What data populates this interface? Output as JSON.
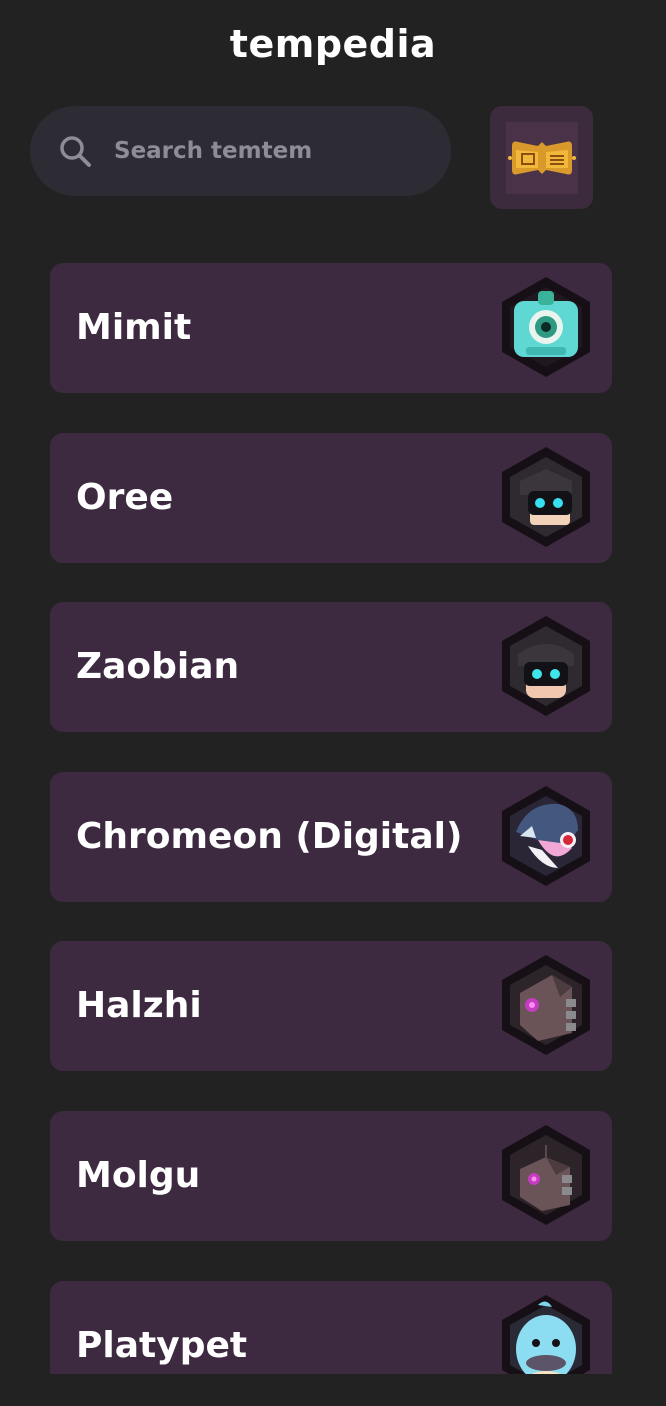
{
  "app": {
    "title": "tempedia"
  },
  "search": {
    "placeholder": "Search temtem",
    "value": ""
  },
  "tempedia_button": {
    "icon": "tempedia-book-icon"
  },
  "colors": {
    "background": "#222222",
    "card": "#3d2a40",
    "search_bg": "#2d2b33",
    "text": "#ffffff",
    "placeholder": "#8e8c94"
  },
  "temtem": [
    {
      "name": "Mimit",
      "icon": "mimit-portrait-icon"
    },
    {
      "name": "Oree",
      "icon": "oree-portrait-icon"
    },
    {
      "name": "Zaobian",
      "icon": "zaobian-portrait-icon"
    },
    {
      "name": "Chromeon (Digital)",
      "icon": "chromeon-digital-portrait-icon"
    },
    {
      "name": "Halzhi",
      "icon": "halzhi-portrait-icon"
    },
    {
      "name": "Molgu",
      "icon": "molgu-portrait-icon"
    },
    {
      "name": "Platypet",
      "icon": "platypet-portrait-icon"
    }
  ]
}
